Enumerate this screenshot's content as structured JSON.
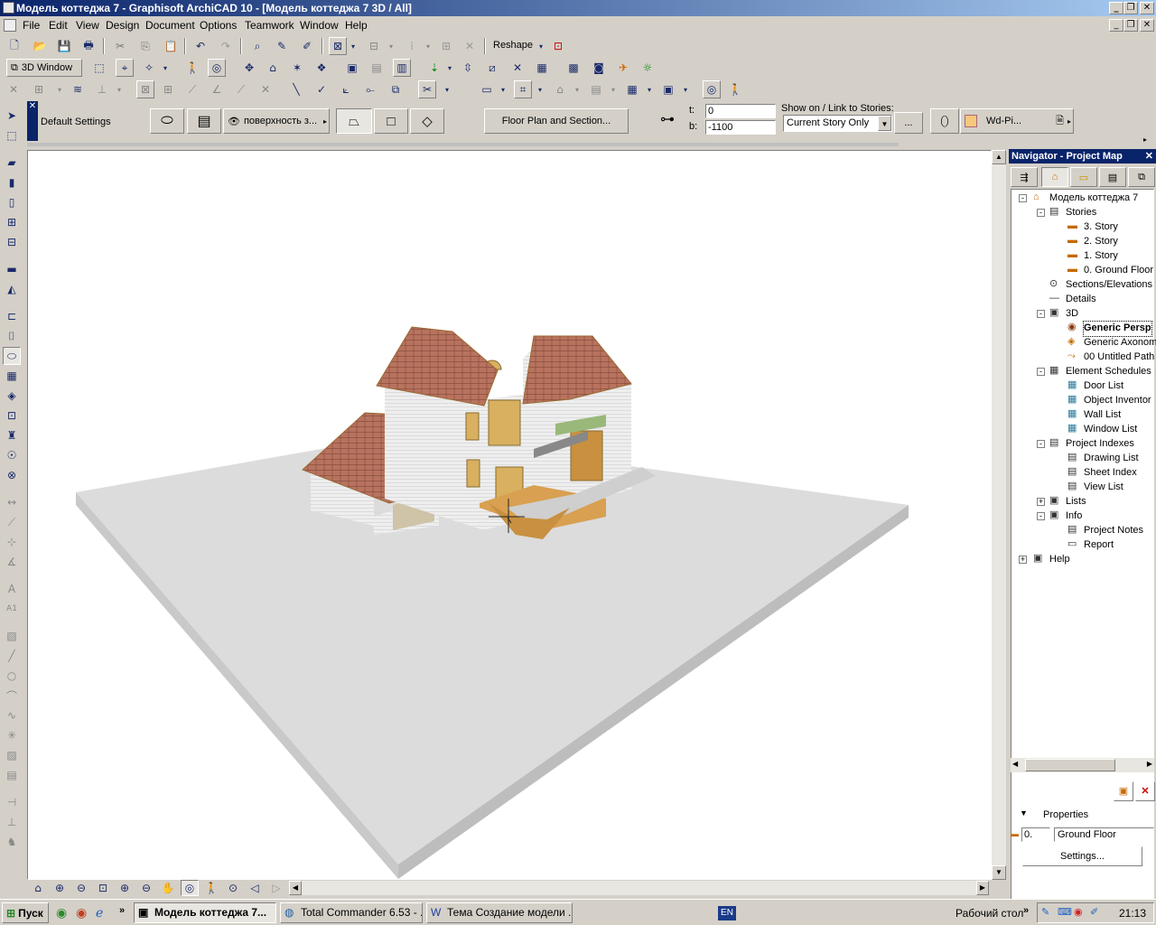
{
  "window": {
    "title": "Модель коттеджа 7 - Graphisoft ArchiCAD 10 - [Модель коттеджа 7 3D / All]",
    "min_label": "_",
    "restore_label": "❐",
    "close_label": "✕"
  },
  "menu": {
    "items": [
      "File",
      "Edit",
      "View",
      "Design",
      "Document",
      "Options",
      "Teamwork",
      "Window",
      "Help"
    ]
  },
  "toolbar": {
    "reshape_label": "Reshape",
    "view_label": "3D Window"
  },
  "infobox": {
    "default_settings": "Default Settings",
    "surface_label": "поверхность з...",
    "floorplan_button": "Floor Plan and Section...",
    "t_label": "t:",
    "b_label": "b:",
    "t_value": "0",
    "b_value": "-1100",
    "show_on_label": "Show on / Link to Stories:",
    "story_select": "Current Story Only",
    "dots_label": "...",
    "wd_label": "Wd-Pi..."
  },
  "navigator": {
    "title": "Navigator - Project Map",
    "tree": [
      {
        "label": "Модель коттеджа 7",
        "icon": "house-icon",
        "level": 0,
        "toggle": "-"
      },
      {
        "label": "Stories",
        "icon": "stories-icon",
        "level": 1,
        "toggle": "-"
      },
      {
        "label": "3. Story",
        "icon": "story-icon",
        "level": 2,
        "toggle": ""
      },
      {
        "label": "2. Story",
        "icon": "story-icon",
        "level": 2,
        "toggle": ""
      },
      {
        "label": "1. Story",
        "icon": "story-icon",
        "level": 2,
        "toggle": ""
      },
      {
        "label": "0. Ground Floor",
        "icon": "story-icon",
        "level": 2,
        "toggle": ""
      },
      {
        "label": "Sections/Elevations",
        "icon": "section-icon",
        "level": 1,
        "toggle": ""
      },
      {
        "label": "Details",
        "icon": "details-icon",
        "level": 1,
        "toggle": ""
      },
      {
        "label": "3D",
        "icon": "3d-icon",
        "level": 1,
        "toggle": "-"
      },
      {
        "label": "Generic Persp",
        "icon": "camera-icon",
        "level": 2,
        "toggle": "",
        "selected": true
      },
      {
        "label": "Generic Axonom",
        "icon": "axon-icon",
        "level": 2,
        "toggle": ""
      },
      {
        "label": "00 Untitled Path",
        "icon": "path-icon",
        "level": 2,
        "toggle": ""
      },
      {
        "label": "Element Schedules",
        "icon": "schedule-icon",
        "level": 1,
        "toggle": "-"
      },
      {
        "label": "Door List",
        "icon": "list-icon",
        "level": 2,
        "toggle": ""
      },
      {
        "label": "Object Inventor",
        "icon": "list-icon",
        "level": 2,
        "toggle": ""
      },
      {
        "label": "Wall List",
        "icon": "list-icon",
        "level": 2,
        "toggle": ""
      },
      {
        "label": "Window List",
        "icon": "list-icon",
        "level": 2,
        "toggle": ""
      },
      {
        "label": "Project Indexes",
        "icon": "index-icon",
        "level": 1,
        "toggle": "-"
      },
      {
        "label": "Drawing List",
        "icon": "index-item-icon",
        "level": 2,
        "toggle": ""
      },
      {
        "label": "Sheet Index",
        "icon": "index-item-icon",
        "level": 2,
        "toggle": ""
      },
      {
        "label": "View List",
        "icon": "index-item-icon",
        "level": 2,
        "toggle": ""
      },
      {
        "label": "Lists",
        "icon": "lists-icon",
        "level": 1,
        "toggle": "+"
      },
      {
        "label": "Info",
        "icon": "info-icon",
        "level": 1,
        "toggle": "-"
      },
      {
        "label": "Project Notes",
        "icon": "notes-icon",
        "level": 2,
        "toggle": ""
      },
      {
        "label": "Report",
        "icon": "report-icon",
        "level": 2,
        "toggle": ""
      },
      {
        "label": "Help",
        "icon": "help-icon",
        "level": 0,
        "toggle": "+"
      }
    ],
    "properties_label": "Properties",
    "story_num": "0.",
    "story_name": "Ground Floor",
    "settings_button": "Settings..."
  },
  "taskbar": {
    "start": "Пуск",
    "tasks": [
      "Модель коттеджа 7...",
      "Total Commander 6.53 - ...",
      "Тема Создание модели ..."
    ],
    "lang": "EN",
    "desktop": "Рабочий стол",
    "chevron": "»",
    "clock": "21:13"
  },
  "colors": {
    "title_start": "#0a246a",
    "title_end": "#a6caf0",
    "roof": "#b8735f",
    "ground": "#dcdcdc"
  }
}
